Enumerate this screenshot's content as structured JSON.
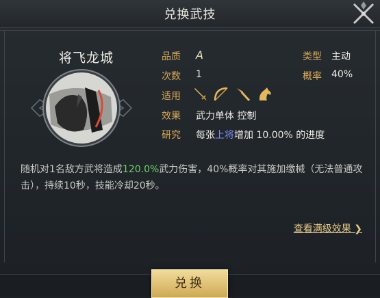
{
  "header": {
    "title": "兑换武技"
  },
  "skill": {
    "name": "将飞龙城",
    "quality_label": "品质",
    "quality_value": "A",
    "count_label": "次数",
    "count_value": "1",
    "type_label": "类型",
    "type_value": "主动",
    "rate_label": "概率",
    "rate_value": "40%",
    "applies_label": "适用",
    "applies_icons": [
      "sword-icon",
      "bow-icon",
      "spear-icon",
      "horse-icon"
    ],
    "effect_label": "效果",
    "effect_value": "武力单体 控制",
    "research_label": "研究",
    "research_prefix": "每张",
    "research_highlight": "上将",
    "research_suffix": "增加 10.00% 的进度"
  },
  "description": {
    "part1": "随机对1名敌方武将造成",
    "highlight": "120.0%",
    "part2": "武力伤害，40%概率对其施加缴械（无法普通攻击），持续10秒，技能冷却20秒。"
  },
  "more_link": "查看满级效果",
  "more_link_arrow": "❯",
  "exchange_button": "兑换",
  "colors": {
    "label": "#d8a85a",
    "highlight_green": "#6ed26a",
    "highlight_blue": "#7b8ff5",
    "button": "#e3c37a"
  }
}
